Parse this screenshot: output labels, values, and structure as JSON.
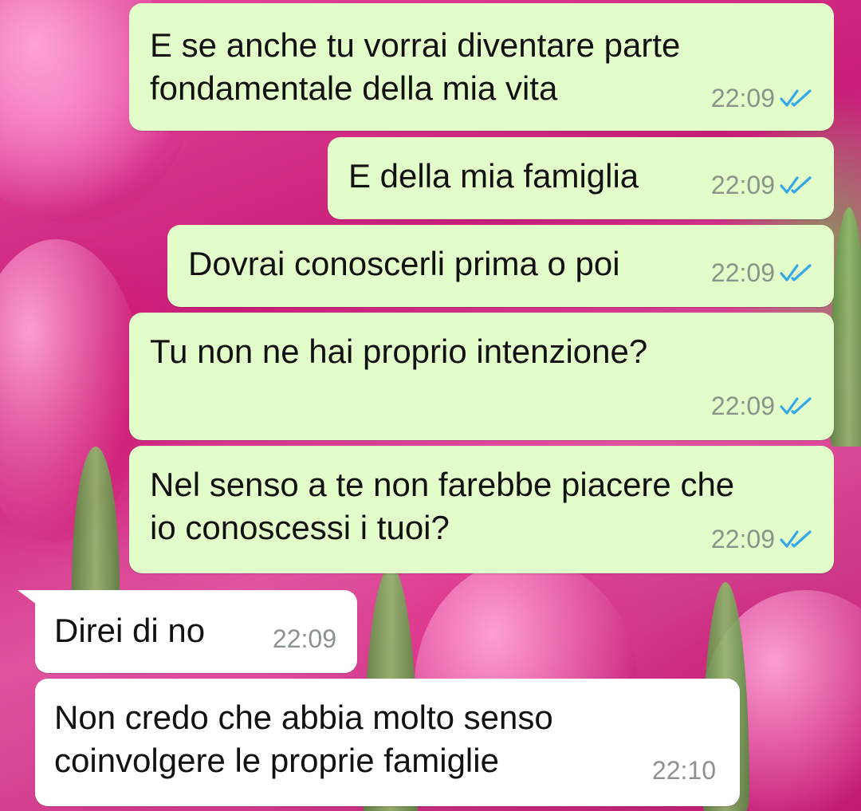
{
  "colors": {
    "outgoing_bubble": "#e2fdc9",
    "incoming_bubble": "#ffffff",
    "read_ticks": "#34a8e6",
    "timestamp": "#8a948a"
  },
  "messages": [
    {
      "direction": "outgoing",
      "text": "E se anche tu vorrai diventare parte\nfondamentale della mia vita",
      "time": "22:09",
      "status_icon": "double-check-read-icon"
    },
    {
      "direction": "outgoing",
      "text": "E della mia famiglia",
      "time": "22:09",
      "status_icon": "double-check-read-icon"
    },
    {
      "direction": "outgoing",
      "text": "Dovrai conoscerli prima o poi",
      "time": "22:09",
      "status_icon": "double-check-read-icon"
    },
    {
      "direction": "outgoing",
      "text": "Tu non ne hai proprio intenzione?",
      "time": "22:09",
      "status_icon": "double-check-read-icon"
    },
    {
      "direction": "outgoing",
      "text": "Nel senso a te non farebbe piacere che\nio conoscessi i tuoi?",
      "time": "22:09",
      "status_icon": "double-check-read-icon"
    },
    {
      "direction": "incoming",
      "text": "Direi di no",
      "time": "22:09"
    },
    {
      "direction": "incoming",
      "text": "Non credo che abbia molto senso\ncoinvolgere le proprie famiglie",
      "time": "22:10"
    }
  ]
}
